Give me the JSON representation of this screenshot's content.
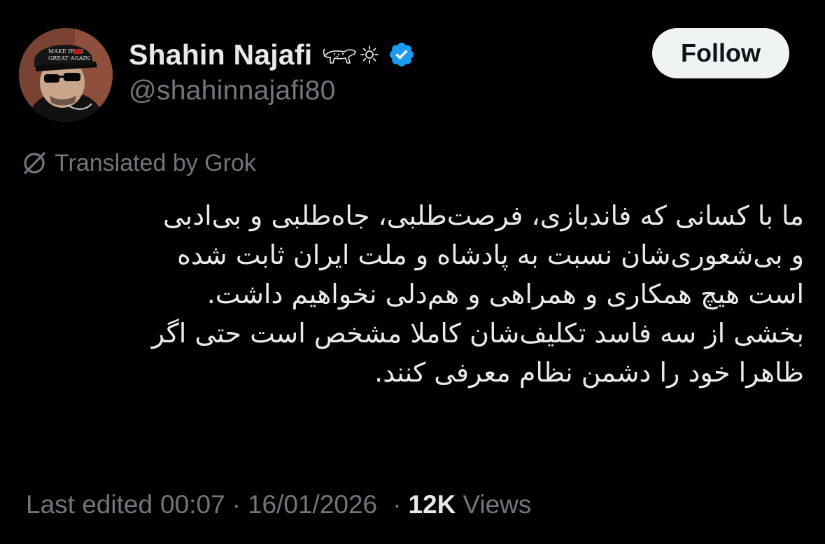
{
  "author": {
    "display_name": "Shahin Najafi",
    "name_emojis": [
      "cheetah-emoji",
      "sun-emoji"
    ],
    "verified": true,
    "handle": "@shahinnajafi80",
    "avatar_cap_text": "MAKE IRAN GREAT AGAIN"
  },
  "actions": {
    "follow_label": "Follow"
  },
  "translation": {
    "label": "Translated by Grok"
  },
  "tweet": {
    "lines": [
      "ما با کسانی که فاندبازی، فرصت‌طلبی، جاه‌طلبی  و بی‌ادبی",
      "و بی‌شعوری‌شان نسبت به پادشاه و ملت ایران ثابت شده",
      "است هیچ همکاری و همراهی و هم‌دلی نخواهیم داشت.",
      "بخشی از سه فاسد تکلیف‌شان کاملا مشخص است حتی اگر",
      "ظاهرا خود را دشمن نظام معرفی کنند."
    ]
  },
  "meta": {
    "edited_label": "Last edited",
    "time": "00:07",
    "date": "16/01/2026",
    "separator": "·",
    "views_count": "12K",
    "views_label": "Views"
  },
  "colors": {
    "background": "#000000",
    "text_primary": "#e7e9ea",
    "text_secondary": "#71767b",
    "verified_blue": "#1d9bf0",
    "follow_bg": "#eff3f4",
    "follow_text": "#0f1419"
  }
}
